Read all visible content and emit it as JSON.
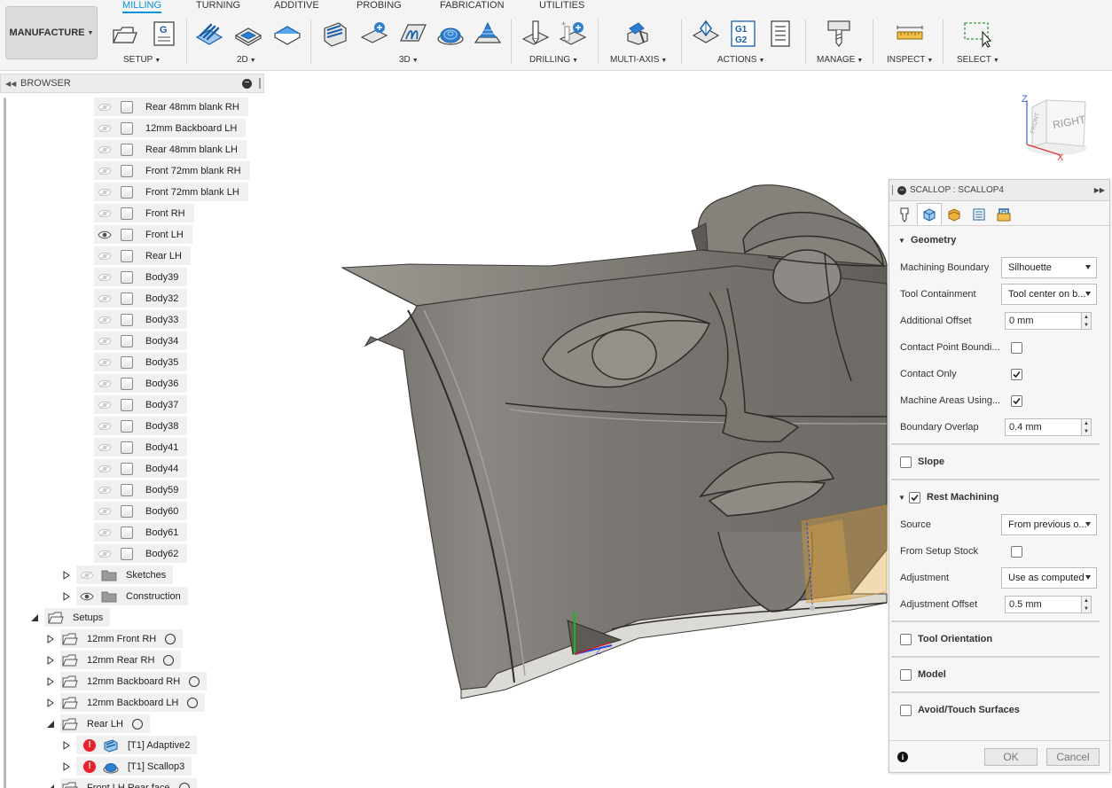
{
  "workspace": {
    "label": "MANUFACTURE"
  },
  "tabs": [
    {
      "label": "MILLING",
      "active": true
    },
    {
      "label": "TURNING"
    },
    {
      "label": "ADDITIVE"
    },
    {
      "label": "PROBING"
    },
    {
      "label": "FABRICATION"
    },
    {
      "label": "UTILITIES"
    }
  ],
  "toolbar_groups": [
    "SETUP",
    "2D",
    "3D",
    "DRILLING",
    "MULTI-AXIS",
    "ACTIONS",
    "MANAGE",
    "INSPECT",
    "SELECT"
  ],
  "actions_icon_text": {
    "line1": "G1",
    "line2": "G2"
  },
  "setup_icon_text": "G",
  "browser": {
    "title": "BROWSER",
    "bodies": [
      {
        "label": "Rear 48mm blank RH",
        "visible": false
      },
      {
        "label": "12mm Backboard LH",
        "visible": false
      },
      {
        "label": "Rear 48mm blank LH",
        "visible": false
      },
      {
        "label": "Front  72mm blank RH",
        "visible": false
      },
      {
        "label": "Front  72mm blank LH",
        "visible": false
      },
      {
        "label": "Front RH",
        "visible": false
      },
      {
        "label": "Front LH",
        "visible": true
      },
      {
        "label": "Rear LH",
        "visible": false
      },
      {
        "label": "Body39",
        "visible": false
      },
      {
        "label": "Body32",
        "visible": false
      },
      {
        "label": "Body33",
        "visible": false
      },
      {
        "label": "Body34",
        "visible": false
      },
      {
        "label": "Body35",
        "visible": false
      },
      {
        "label": "Body36",
        "visible": false
      },
      {
        "label": "Body37",
        "visible": false
      },
      {
        "label": "Body38",
        "visible": false
      },
      {
        "label": "Body41",
        "visible": false
      },
      {
        "label": "Body44",
        "visible": false
      },
      {
        "label": "Body59",
        "visible": false
      },
      {
        "label": "Body60",
        "visible": false
      },
      {
        "label": "Body61",
        "visible": false
      },
      {
        "label": "Body62",
        "visible": false
      }
    ],
    "folders": [
      {
        "label": "Sketches",
        "visible": false
      },
      {
        "label": "Construction",
        "visible": true
      }
    ],
    "setups_label": "Setups",
    "setups": [
      {
        "label": "12mm Front RH"
      },
      {
        "label": "12mm Rear RH"
      },
      {
        "label": "12mm Backboard RH"
      },
      {
        "label": "12mm Backboard LH"
      },
      {
        "label": "Rear LH",
        "expanded": true
      }
    ],
    "operations": [
      {
        "label": "[T1] Adaptive2",
        "error": true
      },
      {
        "label": "[T1] Scallop3",
        "error": true
      }
    ],
    "partial_next_setup": "Front LH Rear face"
  },
  "viewcube": {
    "face_label": "RIGHT",
    "side_label": "FRONT",
    "axis_z": "Z",
    "axis_x": "X"
  },
  "panel": {
    "title": "SCALLOP : SCALLOP4",
    "sections": {
      "geometry": "Geometry",
      "slope": "Slope",
      "rest_machining": "Rest Machining",
      "tool_orientation": "Tool Orientation",
      "model": "Model",
      "avoid_touch": "Avoid/Touch Surfaces"
    },
    "geometry_rows": {
      "machining_boundary": {
        "label": "Machining Boundary",
        "value": "Silhouette"
      },
      "tool_containment": {
        "label": "Tool Containment",
        "value": "Tool center on b..."
      },
      "additional_offset": {
        "label": "Additional Offset",
        "value": "0 mm"
      },
      "contact_point_boundary": {
        "label": "Contact Point Boundi...",
        "checked": false
      },
      "contact_only": {
        "label": "Contact Only",
        "checked": true
      },
      "machine_areas": {
        "label": "Machine Areas Using...",
        "checked": true
      },
      "boundary_overlap": {
        "label": "Boundary Overlap",
        "value": "0.4 mm"
      }
    },
    "slope_checked": false,
    "rest_machining_checked": true,
    "rest_rows": {
      "source": {
        "label": "Source",
        "value": "From previous o..."
      },
      "from_setup_stock": {
        "label": "From Setup Stock",
        "checked": false
      },
      "adjustment": {
        "label": "Adjustment",
        "value": "Use as computed"
      },
      "adjustment_offset": {
        "label": "Adjustment Offset",
        "value": "0.5 mm"
      }
    },
    "tool_orientation_checked": false,
    "model_checked": false,
    "avoid_touch_checked": false,
    "ok_label": "OK",
    "cancel_label": "Cancel",
    "info_label": "i"
  },
  "colors": {
    "accent": "#0696d7",
    "error": "#e8212c",
    "model": "#7b7770"
  }
}
